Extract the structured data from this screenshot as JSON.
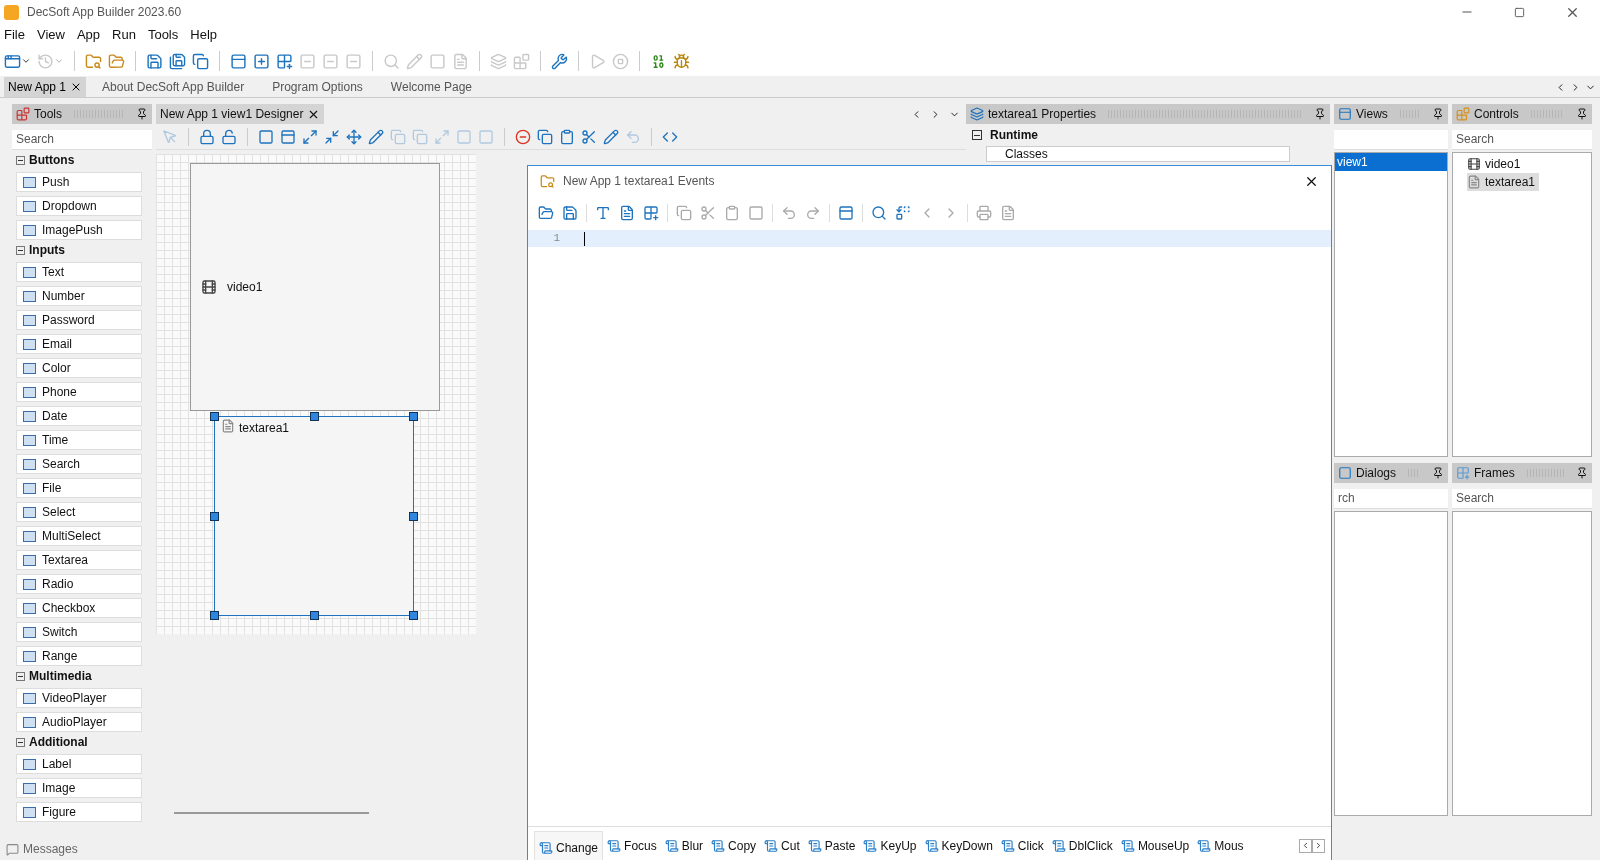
{
  "window": {
    "title": "DecSoft App Builder 2023.60"
  },
  "menu": [
    "File",
    "View",
    "App",
    "Run",
    "Tools",
    "Help"
  ],
  "toolbar": [
    {
      "kind": "button",
      "dropdown": true,
      "disabled": false
    },
    {
      "kind": "button",
      "dropdown": true,
      "disabled": true
    },
    {
      "kind": "separator"
    },
    {
      "kind": "button",
      "dropdown": false,
      "disabled": false
    },
    {
      "kind": "button",
      "dropdown": false,
      "disabled": false
    },
    {
      "kind": "separator"
    },
    {
      "kind": "button",
      "dropdown": false,
      "disabled": false
    },
    {
      "kind": "button",
      "dropdown": false,
      "disabled": false
    },
    {
      "kind": "button",
      "dropdown": false,
      "disabled": false
    },
    {
      "kind": "separator"
    },
    {
      "kind": "button",
      "dropdown": false,
      "disabled": false
    },
    {
      "kind": "button",
      "dropdown": false,
      "disabled": false
    },
    {
      "kind": "button",
      "dropdown": false,
      "disabled": false
    },
    {
      "kind": "button",
      "dropdown": false,
      "disabled": true
    },
    {
      "kind": "button",
      "dropdown": false,
      "disabled": true
    },
    {
      "kind": "button",
      "dropdown": false,
      "disabled": true
    },
    {
      "kind": "separator"
    },
    {
      "kind": "button",
      "dropdown": false,
      "disabled": true
    },
    {
      "kind": "button",
      "dropdown": false,
      "disabled": true
    },
    {
      "kind": "button",
      "dropdown": false,
      "disabled": true
    },
    {
      "kind": "button",
      "dropdown": false,
      "disabled": true
    },
    {
      "kind": "separator"
    },
    {
      "kind": "button",
      "dropdown": false,
      "disabled": true
    },
    {
      "kind": "button",
      "dropdown": false,
      "disabled": true
    },
    {
      "kind": "separator"
    },
    {
      "kind": "button",
      "dropdown": false,
      "disabled": false
    },
    {
      "kind": "separator"
    },
    {
      "kind": "button",
      "dropdown": false,
      "disabled": true
    },
    {
      "kind": "button",
      "dropdown": false,
      "disabled": true
    },
    {
      "kind": "separator"
    },
    {
      "kind": "button",
      "dropdown": false,
      "disabled": false
    },
    {
      "kind": "button",
      "dropdown": false,
      "disabled": false
    }
  ],
  "doc_tabs": [
    {
      "label": "New App 1",
      "selected": true,
      "closable": true
    },
    {
      "label": "About DecSoft App Builder",
      "selected": false,
      "closable": false
    },
    {
      "label": "Program Options",
      "selected": false,
      "closable": false
    },
    {
      "label": "Welcome Page",
      "selected": false,
      "closable": false
    }
  ],
  "tools": {
    "title": "Tools",
    "search": {
      "placeholder": "Search"
    },
    "groups": [
      {
        "title": "Buttons",
        "expanded": true,
        "items": [
          "Push",
          "Dropdown",
          "ImagePush"
        ]
      },
      {
        "title": "Inputs",
        "expanded": true,
        "items": [
          "Text",
          "Number",
          "Password",
          "Email",
          "Color",
          "Phone",
          "Date",
          "Time",
          "Search",
          "File",
          "Select",
          "MultiSelect",
          "Textarea",
          "Radio",
          "Checkbox",
          "Switch",
          "Range"
        ]
      },
      {
        "title": "Multimedia",
        "expanded": true,
        "items": [
          "VideoPlayer",
          "AudioPlayer"
        ]
      },
      {
        "title": "Additional",
        "expanded": true,
        "items": [
          "Label",
          "Image",
          "Figure"
        ]
      }
    ]
  },
  "messages": {
    "label": "Messages"
  },
  "designer": {
    "tab": "New App 1 view1 Designer",
    "toolbar": [
      {
        "disabled": true
      },
      {
        "kind": "separator"
      },
      {
        "disabled": false
      },
      {
        "disabled": false
      },
      {
        "kind": "separator"
      },
      {
        "disabled": false
      },
      {
        "disabled": false
      },
      {
        "disabled": false
      },
      {
        "disabled": false
      },
      {
        "disabled": false
      },
      {
        "disabled": false
      },
      {
        "disabled": true
      },
      {
        "disabled": true
      },
      {
        "disabled": true
      },
      {
        "disabled": true
      },
      {
        "disabled": true
      },
      {
        "kind": "separator"
      },
      {
        "disabled": false
      },
      {
        "disabled": false
      },
      {
        "disabled": false
      },
      {
        "disabled": false
      },
      {
        "disabled": false
      },
      {
        "disabled": true
      },
      {
        "kind": "separator"
      },
      {
        "disabled": false
      }
    ],
    "controls": [
      {
        "label": "video1",
        "kind": "video",
        "selected": false
      },
      {
        "label": "textarea1",
        "kind": "textarea",
        "selected": true
      }
    ]
  },
  "properties": {
    "title": "textarea1 Properties",
    "section": {
      "title": "Runtime",
      "expanded": true
    },
    "rows": [
      {
        "name": "Classes"
      }
    ]
  },
  "views": {
    "title": "Views",
    "items": [
      {
        "label": "view1",
        "selected": true
      }
    ]
  },
  "controls": {
    "title": "Controls",
    "search": {
      "placeholder": "Search"
    },
    "items": [
      {
        "label": "video1",
        "kind": "video",
        "selected": false
      },
      {
        "label": "textarea1",
        "kind": "textarea",
        "selected": true
      }
    ]
  },
  "dialogs": {
    "title": "Dialogs",
    "search": {
      "placeholder": "rch"
    }
  },
  "frames": {
    "title": "Frames",
    "search": {
      "placeholder": "Search"
    }
  },
  "events": {
    "title": "New App 1 textarea1 Events",
    "line_numbers": [
      "1"
    ],
    "tabs": [
      {
        "label": "Change",
        "selected": true
      },
      {
        "label": "Focus",
        "selected": false
      },
      {
        "label": "Blur",
        "selected": false
      },
      {
        "label": "Copy",
        "selected": false
      },
      {
        "label": "Cut",
        "selected": false
      },
      {
        "label": "Paste",
        "selected": false
      },
      {
        "label": "KeyUp",
        "selected": false
      },
      {
        "label": "KeyDown",
        "selected": false
      },
      {
        "label": "Click",
        "selected": false
      },
      {
        "label": "DblClick",
        "selected": false
      },
      {
        "label": "MouseUp",
        "selected": false
      },
      {
        "label": "Mous",
        "selected": false
      }
    ]
  }
}
